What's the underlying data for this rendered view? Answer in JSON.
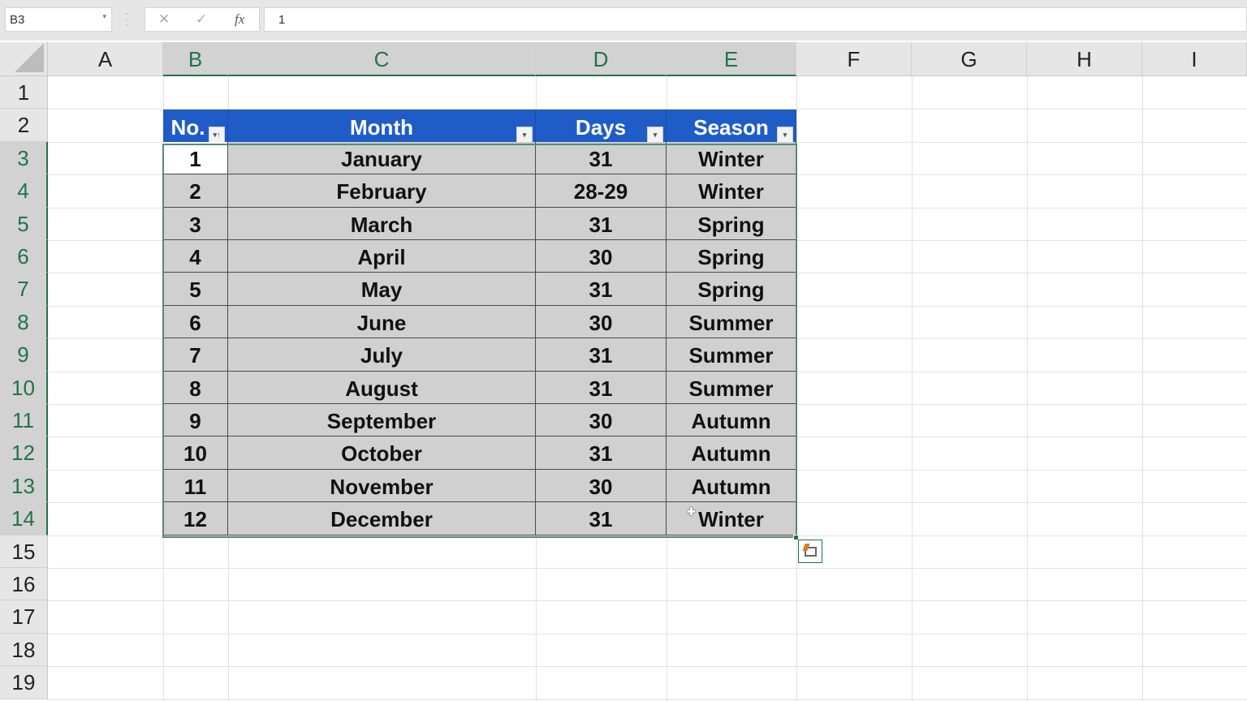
{
  "formula_bar": {
    "name_box": "B3",
    "cancel_icon": "✕",
    "enter_icon": "✓",
    "fx_label": "fx",
    "formula_value": "1"
  },
  "columns": [
    "A",
    "B",
    "C",
    "D",
    "E",
    "F",
    "G",
    "H",
    "I"
  ],
  "rows": [
    "1",
    "2",
    "3",
    "4",
    "5",
    "6",
    "7",
    "8",
    "9",
    "10",
    "11",
    "12",
    "13",
    "14",
    "15",
    "16",
    "17",
    "18",
    "19"
  ],
  "table": {
    "headers": [
      "No.",
      "Month",
      "Days",
      "Season"
    ],
    "rows": [
      [
        "1",
        "January",
        "31",
        "Winter"
      ],
      [
        "2",
        "February",
        "28-29",
        "Winter"
      ],
      [
        "3",
        "March",
        "31",
        "Spring"
      ],
      [
        "4",
        "April",
        "30",
        "Spring"
      ],
      [
        "5",
        "May",
        "31",
        "Spring"
      ],
      [
        "6",
        "June",
        "30",
        "Summer"
      ],
      [
        "7",
        "July",
        "31",
        "Summer"
      ],
      [
        "8",
        "August",
        "31",
        "Summer"
      ],
      [
        "9",
        "September",
        "30",
        "Autumn"
      ],
      [
        "10",
        "October",
        "31",
        "Autumn"
      ],
      [
        "11",
        "November",
        "30",
        "Autumn"
      ],
      [
        "12",
        "December",
        "31",
        "Winter"
      ]
    ]
  },
  "colors": {
    "header_fill": "#1f5cc8",
    "selection_fill": "#d0d0d0",
    "selection_accent": "#217346"
  }
}
